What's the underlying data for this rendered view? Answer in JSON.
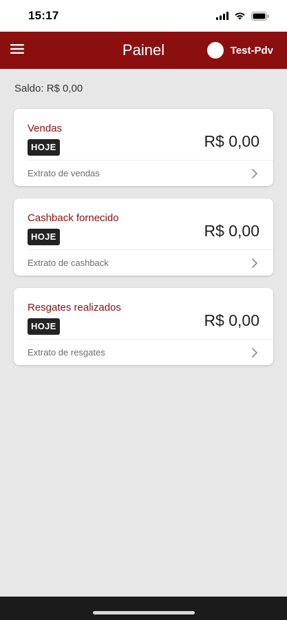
{
  "status_bar": {
    "time": "15:17",
    "icons": [
      "cellular-signal-icon",
      "wifi-icon",
      "battery-icon"
    ]
  },
  "app_bar": {
    "title": "Painel",
    "menu_icon": "hamburger-menu-icon",
    "user_name": "Test-Pdv",
    "background_color": "#8b0f0f"
  },
  "saldo": "Saldo: R$ 0,00",
  "cards": [
    {
      "title": "Vendas",
      "badge": "HOJE",
      "value": "R$ 0,00",
      "link_label": "Extrato de vendas"
    },
    {
      "title": "Cashback fornecido",
      "badge": "HOJE",
      "value": "R$ 0,00",
      "link_label": "Extrato de cashback"
    },
    {
      "title": "Resgates realizados",
      "badge": "HOJE",
      "value": "R$ 0,00",
      "link_label": "Extrato de resgates"
    }
  ]
}
